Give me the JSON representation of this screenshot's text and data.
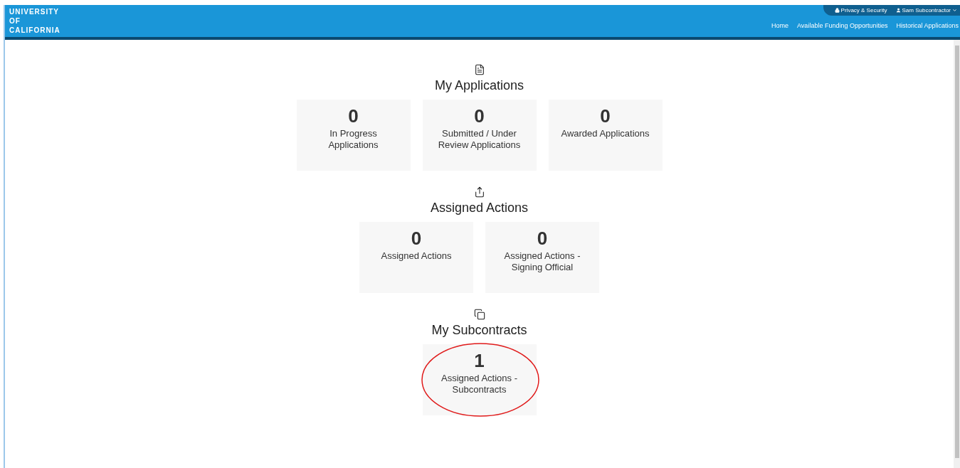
{
  "header": {
    "logo_lines": [
      "UNIVERSITY",
      "OF",
      "CALIFORNIA"
    ],
    "utility_links": [
      {
        "kind": "lock",
        "label": "Privacy & Security"
      },
      {
        "kind": "user",
        "label": "Sam Subcontractor",
        "dropdown": true
      }
    ],
    "nav": [
      "Home",
      "Available Funding Opportunities",
      "Historical Applications"
    ]
  },
  "sections": [
    {
      "kind": "document",
      "title": "My Applications",
      "cards": [
        {
          "count": "0",
          "label": "In Progress Applications",
          "circled": false
        },
        {
          "count": "0",
          "label": "Submitted / Under Review Applications",
          "circled": false
        },
        {
          "count": "0",
          "label": "Awarded Applications",
          "circled": false
        }
      ]
    },
    {
      "kind": "share",
      "title": "Assigned Actions",
      "cards": [
        {
          "count": "0",
          "label": "Assigned Actions",
          "circled": false
        },
        {
          "count": "0",
          "label": "Assigned Actions - Signing Official",
          "circled": false
        }
      ]
    },
    {
      "kind": "copy",
      "title": "My Subcontracts",
      "cards": [
        {
          "count": "1",
          "label": "Assigned Actions - Subcontracts",
          "circled": true
        }
      ]
    }
  ]
}
